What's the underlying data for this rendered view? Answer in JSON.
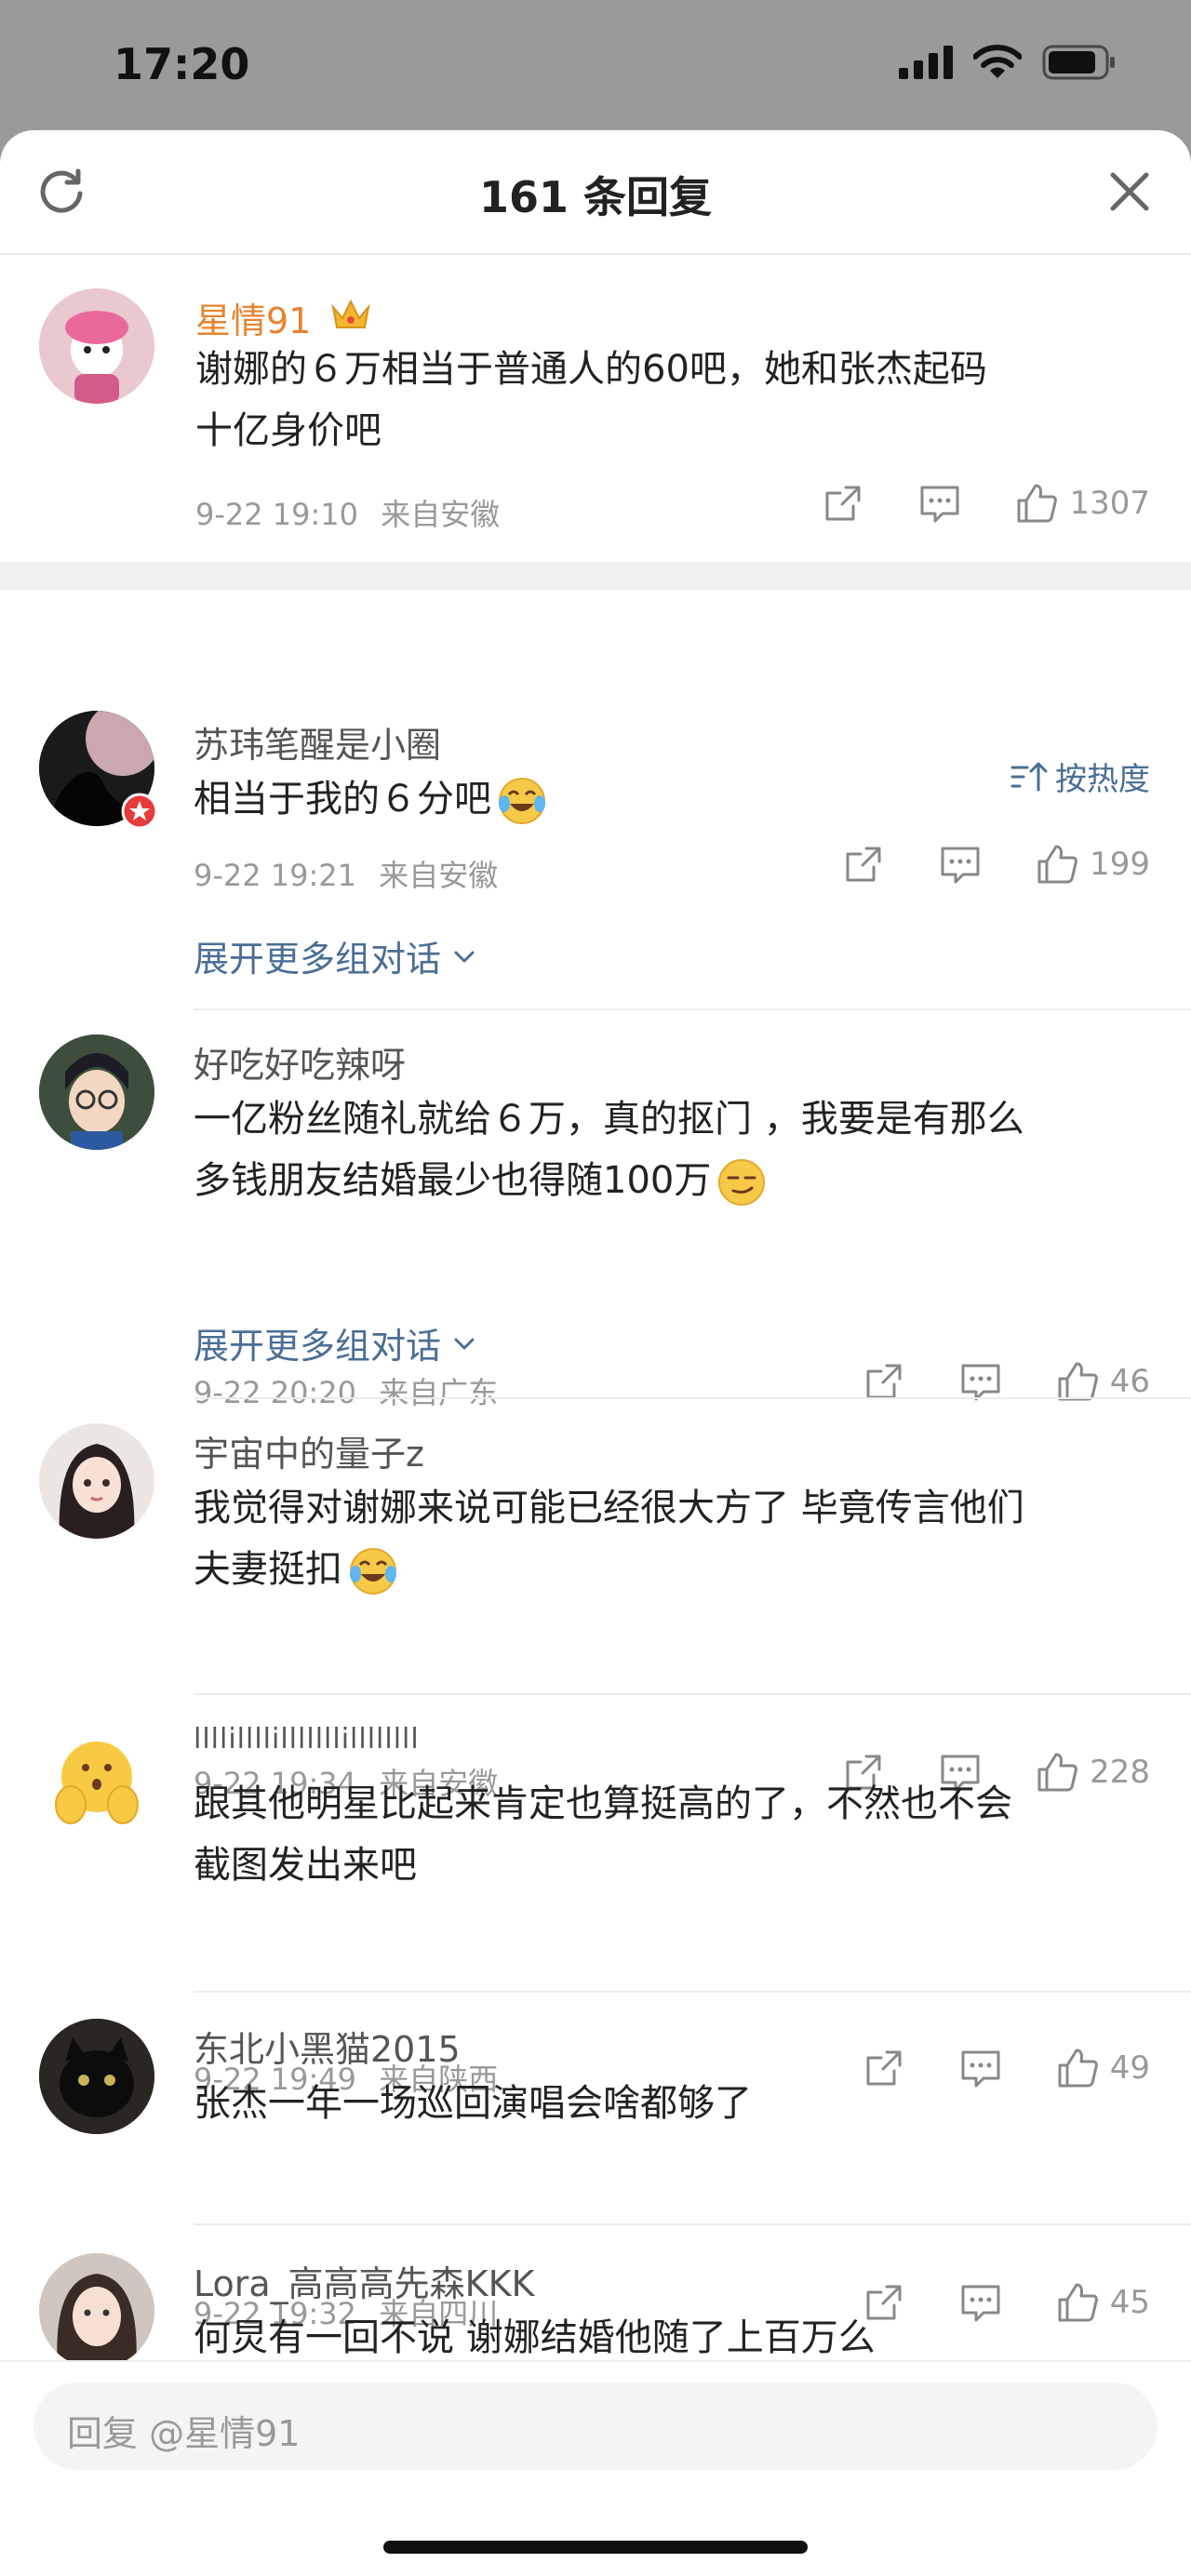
{
  "status_bar": {
    "time": "17:20"
  },
  "header": {
    "title": "161 条回复"
  },
  "root_comment": {
    "username": "星情91",
    "text_line1": "谢娜的６万相当于普通人的60吧，她和张杰起码",
    "text_line2": "十亿身价吧",
    "time": "9-22 19:10",
    "location": "来自安徽",
    "likes": "1307"
  },
  "sort": {
    "label": "按热度"
  },
  "replies": [
    {
      "username": "苏玮笔醒是小圈",
      "line1": "相当于我的６分吧",
      "line2": "",
      "time": "9-22 19:21",
      "location": "来自安徽",
      "likes": "199",
      "expand": "展开更多组对话"
    },
    {
      "username": "好吃好吃辣呀",
      "line1": "一亿粉丝随礼就给６万，真的抠门 ，我要是有那么",
      "line2": "多钱朋友结婚最少也得随100万",
      "time": "9-22 20:20",
      "location": "来自广东",
      "likes": "46",
      "expand": "展开更多组对话"
    },
    {
      "username": "宇宙中的量子z",
      "line1": "我觉得对谢娜来说可能已经很大方了 毕竟传言他们",
      "line2": "夫妻挺扣",
      "time": "9-22 19:34",
      "location": "来自安徽",
      "likes": "228",
      "expand": ""
    },
    {
      "username": "llllillllilllllllillllllll",
      "line1": "跟其他明星比起来肯定也算挺高的了，不然也不会",
      "line2": "截图发出来吧",
      "time": "9-22 19:49",
      "location": "来自陕西",
      "likes": "49",
      "expand": ""
    },
    {
      "username": "东北小黑猫2015",
      "line1": "张杰一年一场巡回演唱会啥都够了",
      "line2": "",
      "time": "9-22 19:32",
      "location": "来自四川",
      "likes": "45",
      "expand": ""
    },
    {
      "username": "Lora_高高高先森KKK",
      "line1": "何炅有一回不说 谢娜结婚他随了上百万么",
      "line2": "",
      "time": "",
      "location": "",
      "likes": "",
      "expand": ""
    }
  ],
  "bottom": {
    "reply_placeholder": "回复 @星情91"
  },
  "colors": {
    "accent_orange": "#e8832e",
    "link_blue": "#4a6e95",
    "meta_gray": "#999999"
  }
}
